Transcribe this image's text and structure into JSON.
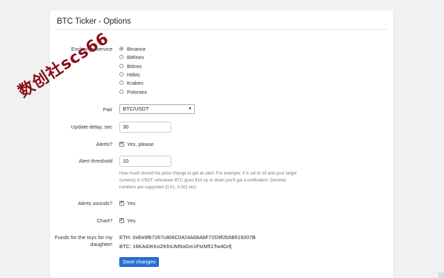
{
  "page": {
    "title": "BTC Ticker - Options"
  },
  "exchange": {
    "label": "Exchange service",
    "options": [
      "Binance",
      "Bitfinex",
      "Bittrex",
      "Hitbtc",
      "Kraken",
      "Poloniex"
    ],
    "selected_index": 0
  },
  "pair": {
    "label": "Pair",
    "value": "BTC/USDT"
  },
  "update_delay": {
    "label": "Update delay, sec",
    "value": "30"
  },
  "alerts": {
    "label": "Alerts?",
    "checkbox_label": "Yes, please",
    "checked": true
  },
  "alert_threshold": {
    "label": "Alert threshold",
    "value": "10",
    "help": "How much should the price change to get an alert. For example, if is set to 10 and your target currency is USDT, whenever BTC goes $10 up or down you'll get a notification. Decimal numbers are supported (0.01, 0.001 etc)"
  },
  "alerts_sounds": {
    "label": "Alerts sounds?",
    "checkbox_label": "Yes",
    "checked": true
  },
  "chart": {
    "label": "Chart?",
    "checkbox_label": "Yes",
    "checked": true
  },
  "funds": {
    "label": "Funds for the toys for my daughter!",
    "eth": "ETH: 0xEe9fb7267c806C0424A68AbF72D9f2b5B519207B",
    "btc": "BTC: 16KAiDKKoZKfnUM5oGm1FtzM51Tw4Grfj"
  },
  "save_button": {
    "label": "Save changes"
  },
  "watermark": {
    "text": "数创社scs66"
  },
  "colors": {
    "primary_button": "#2a6fd3",
    "watermark": "#8a0d18"
  }
}
